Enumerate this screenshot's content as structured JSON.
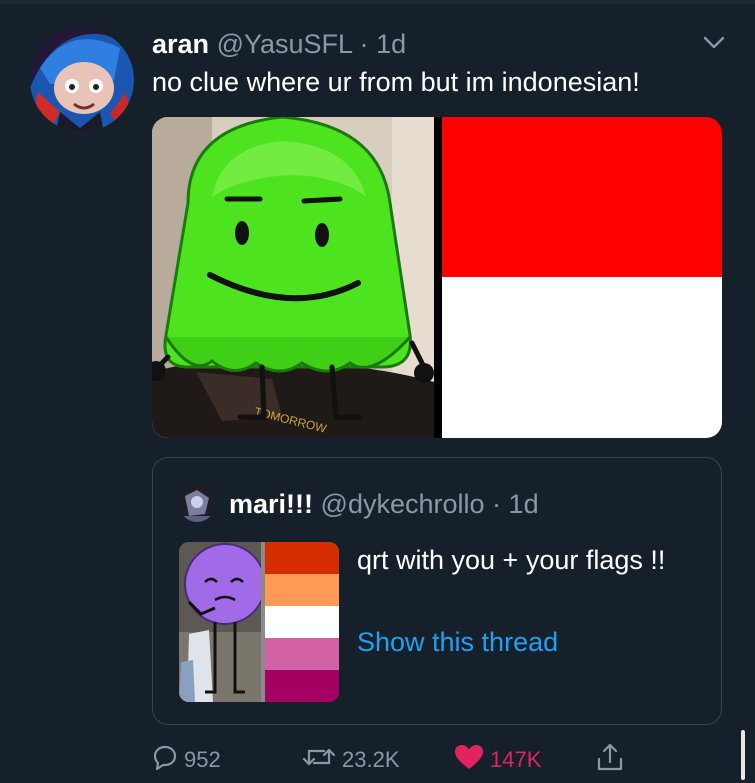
{
  "tweet": {
    "display_name": "aran",
    "handle": "@YasuSFL",
    "separator": "·",
    "time": "1d",
    "text": "no clue where ur from but im indonesian!",
    "image_shirt_text": "TOMORROW"
  },
  "quoted": {
    "display_name": "mari!!!",
    "handle": "@dykechrollo",
    "separator": "·",
    "time": "1d",
    "text": "qrt with you + your flags !!",
    "link": "Show this thread",
    "flag_stripes": [
      "#d52d00",
      "#ff9a56",
      "#ffffff",
      "#d362a4",
      "#a30262"
    ]
  },
  "actions": {
    "reply_count": "952",
    "retweet_count": "23.2K",
    "like_count": "147K",
    "liked": true
  },
  "colors": {
    "background": "#15202b",
    "muted": "#8899a6",
    "link": "#1da1f2",
    "like": "#e0245e",
    "indonesia_red": "#fe0000"
  },
  "icons": [
    "chevron-down-icon",
    "reply-icon",
    "retweet-icon",
    "heart-icon",
    "share-icon"
  ]
}
